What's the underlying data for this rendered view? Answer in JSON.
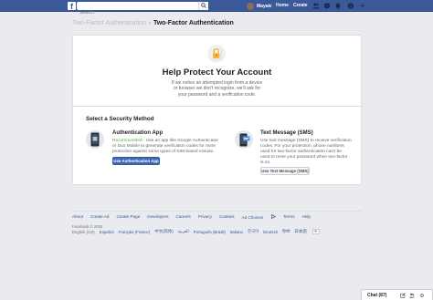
{
  "topbar": {
    "logo": "f",
    "search_placeholder": "Search",
    "profile_name": "Mayate",
    "links": [
      "Home",
      "Create"
    ]
  },
  "breadcrumb": {
    "parent": "Two-Factor Authentication",
    "separator": "›",
    "current": "Two-Factor Authentication"
  },
  "hero": {
    "title": "Help Protect Your Account",
    "description": "If we notice an attempted login from a device or browser we don't recognize, we'll ask for your password and a verification code."
  },
  "security": {
    "title": "Select a Security Method",
    "options": [
      {
        "title": "Authentication App",
        "recommended": "Recommended",
        "description": " · Use an app like Google Authenticator or Duo Mobile to generate verification codes for more protection against some types of SIM-based misuse.",
        "button": "Use Authentication App"
      },
      {
        "title": "Text Message (SMS)",
        "description": "Use text message (SMS) to receive verification codes. For your protection, phone numbers used for two-factor authentication can't be used to reset your password when two-factor is on.",
        "button": "Use Text Message (SMS)"
      }
    ]
  },
  "footer": {
    "links": [
      "About",
      "Create Ad",
      "Create Page",
      "Developers",
      "Careers",
      "Privacy",
      "Cookies",
      "Ad Choices",
      "Terms",
      "Help"
    ],
    "copyright": "Facebook © 2020",
    "current_language": "English (US)",
    "languages": [
      "Español",
      "Français (France)",
      "中文(简体)",
      "العربية",
      "Português (Brasil)",
      "Italiano",
      "한국어",
      "Deutsch",
      "हिन्दी",
      "日本語"
    ],
    "more": "+"
  },
  "chat": {
    "label": "Chat (87)"
  },
  "colors": {
    "brand": "#3b5998",
    "button": "#4267b2",
    "background": "#e9ebee"
  }
}
